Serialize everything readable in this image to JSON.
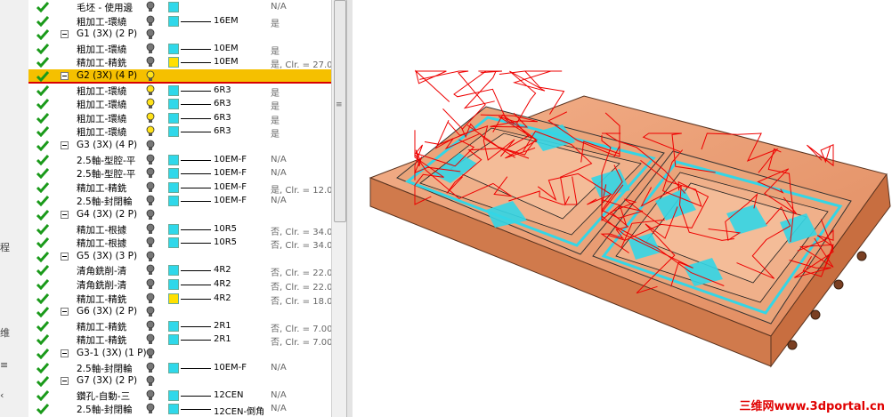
{
  "left_strip": {
    "glyphs": [
      "程",
      "维",
      "≡",
      "‹"
    ]
  },
  "tree": {
    "rows": [
      {
        "kind": "op",
        "name": "毛坯 - 使用邊",
        "bulb": "gray",
        "swatch": "#2fd8ea",
        "tool": "",
        "stock": "N/A"
      },
      {
        "kind": "op",
        "name": "粗加工-環繞",
        "bulb": "gray",
        "swatch": "#2fd8ea",
        "tool": "16EM",
        "stock": "是"
      },
      {
        "kind": "group",
        "name": "G1 (3X) (2 P)",
        "bulb": "gray"
      },
      {
        "kind": "op",
        "name": "粗加工-環繞",
        "bulb": "gray",
        "swatch": "#2fd8ea",
        "tool": "10EM",
        "stock": "是"
      },
      {
        "kind": "op",
        "name": "精加工-精銑",
        "bulb": "gray",
        "swatch": "#ffe000",
        "tool": "10EM",
        "stock": "是, Clr. = 27.0"
      },
      {
        "kind": "group",
        "name": "G2 (3X) (4 P)",
        "bulb": "yellow",
        "selected": true
      },
      {
        "kind": "op",
        "name": "粗加工-環繞",
        "bulb": "yellow",
        "swatch": "#2fd8ea",
        "tool": "6R3",
        "stock": "是"
      },
      {
        "kind": "op",
        "name": "粗加工-環繞",
        "bulb": "yellow",
        "swatch": "#2fd8ea",
        "tool": "6R3",
        "stock": "是"
      },
      {
        "kind": "op",
        "name": "粗加工-環繞",
        "bulb": "yellow",
        "swatch": "#2fd8ea",
        "tool": "6R3",
        "stock": "是"
      },
      {
        "kind": "op",
        "name": "粗加工-環繞",
        "bulb": "yellow",
        "swatch": "#2fd8ea",
        "tool": "6R3",
        "stock": "是"
      },
      {
        "kind": "group",
        "name": "G3 (3X) (4 P)",
        "bulb": "gray"
      },
      {
        "kind": "op",
        "name": "2.5軸-型腔-平",
        "bulb": "gray",
        "swatch": "#2fd8ea",
        "tool": "10EM-F",
        "stock": "N/A"
      },
      {
        "kind": "op",
        "name": "2.5軸-型腔-平",
        "bulb": "gray",
        "swatch": "#2fd8ea",
        "tool": "10EM-F",
        "stock": "N/A"
      },
      {
        "kind": "op",
        "name": "精加工-精銑",
        "bulb": "gray",
        "swatch": "#2fd8ea",
        "tool": "10EM-F",
        "stock": "是, Clr. = 12.0"
      },
      {
        "kind": "op",
        "name": "2.5軸-封閉輪",
        "bulb": "gray",
        "swatch": "#2fd8ea",
        "tool": "10EM-F",
        "stock": "N/A"
      },
      {
        "kind": "group",
        "name": "G4 (3X) (2 P)",
        "bulb": "gray"
      },
      {
        "kind": "op",
        "name": "精加工-根據",
        "bulb": "gray",
        "swatch": "#2fd8ea",
        "tool": "10R5",
        "stock": "否, Clr. = 34.0"
      },
      {
        "kind": "op",
        "name": "精加工-根據",
        "bulb": "gray",
        "swatch": "#2fd8ea",
        "tool": "10R5",
        "stock": "否, Clr. = 34.0"
      },
      {
        "kind": "group",
        "name": "G5 (3X) (3 P)",
        "bulb": "gray"
      },
      {
        "kind": "op",
        "name": "清角銑削-清",
        "bulb": "gray",
        "swatch": "#2fd8ea",
        "tool": "4R2",
        "stock": "否, Clr. = 22.0"
      },
      {
        "kind": "op",
        "name": "清角銑削-清",
        "bulb": "gray",
        "swatch": "#2fd8ea",
        "tool": "4R2",
        "stock": "否, Clr. = 22.0"
      },
      {
        "kind": "op",
        "name": "精加工-精銑",
        "bulb": "gray",
        "swatch": "#ffe000",
        "tool": "4R2",
        "stock": "否, Clr. = 18.0"
      },
      {
        "kind": "group",
        "name": "G6 (3X) (2 P)",
        "bulb": "gray"
      },
      {
        "kind": "op",
        "name": "精加工-精銑",
        "bulb": "gray",
        "swatch": "#2fd8ea",
        "tool": "2R1",
        "stock": "否, Clr. = 7.00"
      },
      {
        "kind": "op",
        "name": "精加工-精銑",
        "bulb": "gray",
        "swatch": "#2fd8ea",
        "tool": "2R1",
        "stock": "否, Clr. = 7.00"
      },
      {
        "kind": "group",
        "name": "G3-1 (3X) (1 P)",
        "bulb": "gray"
      },
      {
        "kind": "op",
        "name": "2.5軸-封閉輪",
        "bulb": "gray",
        "swatch": "#2fd8ea",
        "tool": "10EM-F",
        "stock": "N/A"
      },
      {
        "kind": "group",
        "name": "G7 (3X) (2 P)",
        "bulb": "gray"
      },
      {
        "kind": "op",
        "name": "鑽孔-自動-三",
        "bulb": "gray",
        "swatch": "#2fd8ea",
        "tool": "12CEN",
        "stock": "N/A"
      },
      {
        "kind": "op",
        "name": "2.5軸-封閉輪",
        "bulb": "gray",
        "swatch": "#2fd8ea",
        "tool": "12CEN-倒角",
        "stock": "N/A"
      }
    ]
  },
  "viewport": {
    "part_color": "#e7986a",
    "toolpath_color": "#ee0000",
    "finish_color": "#33d6e6"
  },
  "watermark": {
    "text": "三维网www.3dportal.cn"
  }
}
